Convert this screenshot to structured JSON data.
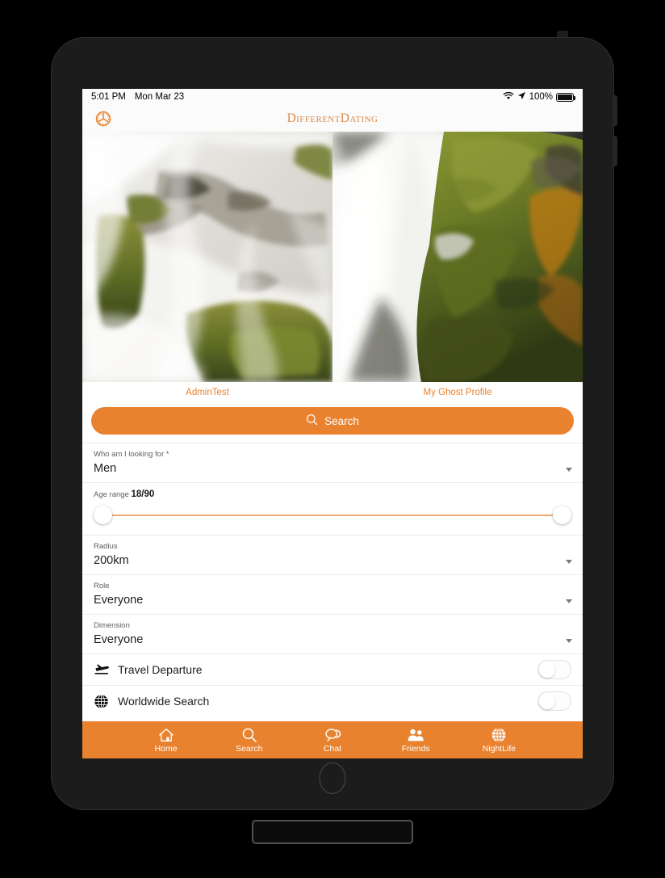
{
  "device": {
    "frame_label": "tablet-frame",
    "home_button": "home-button"
  },
  "status_bar": {
    "time": "5:01 PM",
    "date": "Mon Mar 23",
    "wifi_icon": "wifi-icon",
    "location_icon": "location-arrow-icon",
    "battery_percent": "100%",
    "battery_icon": "battery-full-icon"
  },
  "header": {
    "settings_icon": "settings-wheel-icon",
    "logo": "DifferentDating"
  },
  "photos": [
    {
      "name": "AdminTest",
      "alt": "waterfall-over-mossy-rocks-left"
    },
    {
      "name": "My Ghost Profile",
      "alt": "waterfall-over-mossy-rocks-right"
    }
  ],
  "search": {
    "label": "Search",
    "icon": "search-icon"
  },
  "form": {
    "fields": [
      {
        "label": "Who am I looking for *",
        "value": "Men",
        "caret": "chevron-down-icon"
      },
      {
        "label": "Radius",
        "value": "200km",
        "caret": "chevron-down-icon"
      },
      {
        "label": "Role",
        "value": "Everyone",
        "caret": "chevron-down-icon"
      },
      {
        "label": "Dimension",
        "value": "Everyone",
        "caret": "chevron-down-icon"
      }
    ],
    "age": {
      "label": "Age range",
      "value": "18/90",
      "min": 18,
      "max": 90,
      "range_min": 18,
      "range_max": 90
    },
    "toggles": [
      {
        "label": "Travel Departure",
        "icon": "airplane-departure-icon",
        "state": "off"
      },
      {
        "label": "Worldwide Search",
        "icon": "globe-icon",
        "state": "off"
      }
    ]
  },
  "bottom_nav": {
    "items": [
      {
        "label": "Home",
        "icon": "home-icon"
      },
      {
        "label": "Search",
        "icon": "search-icon"
      },
      {
        "label": "Chat",
        "icon": "chat-bubbles-icon"
      },
      {
        "label": "Friends",
        "icon": "friends-people-icon"
      },
      {
        "label": "NightLife",
        "icon": "globe-icon"
      }
    ]
  },
  "colors": {
    "accent": "#e9822f",
    "logo": "#d98b4a",
    "slider_track": "#edaa72",
    "screen_bg": "#ffffff",
    "frame": "#1c1c1c"
  }
}
